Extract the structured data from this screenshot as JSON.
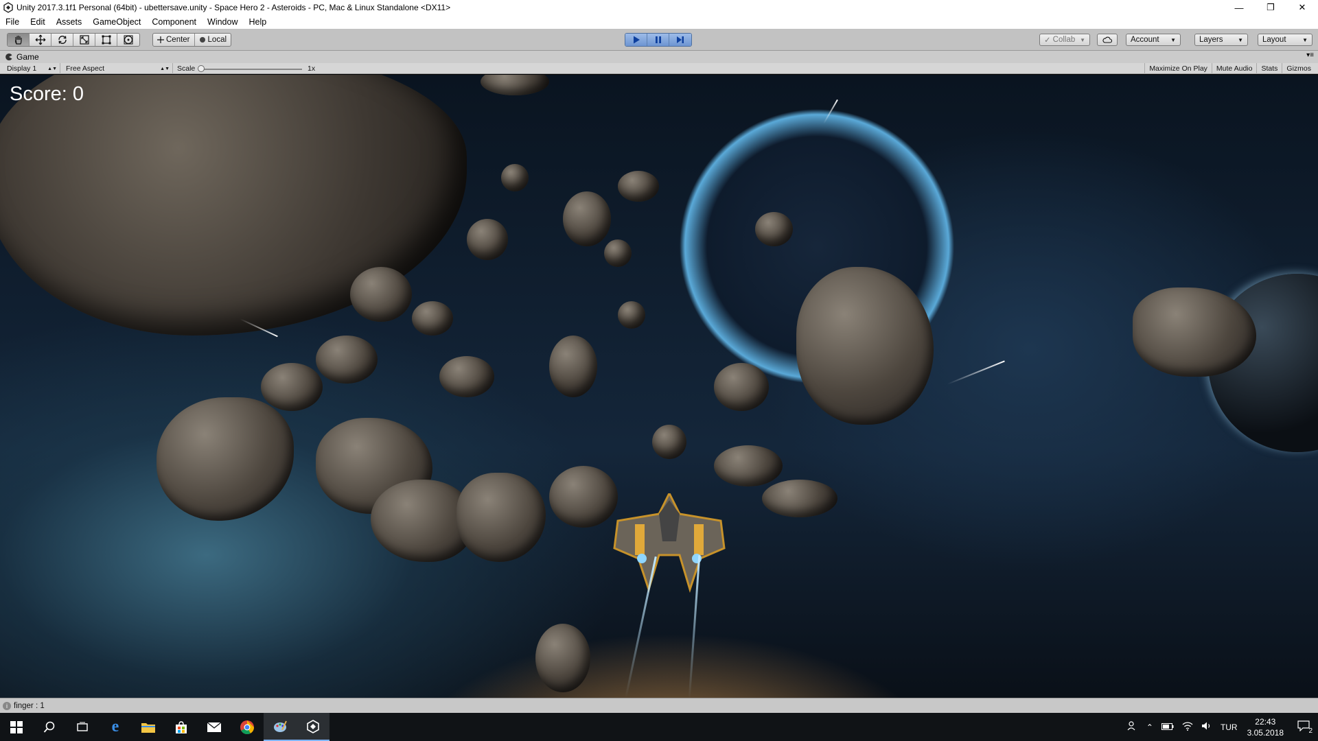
{
  "window": {
    "title": "Unity 2017.3.1f1 Personal (64bit) - ubettersave.unity - Space Hero 2 - Asteroids - PC, Mac & Linux Standalone <DX11>",
    "minimize_icon": "minimize-icon",
    "restore_icon": "restore-icon",
    "close_icon": "close-icon"
  },
  "menu": [
    "File",
    "Edit",
    "Assets",
    "GameObject",
    "Component",
    "Window",
    "Help"
  ],
  "toolbar": {
    "tools": [
      "hand-icon",
      "move-icon",
      "rotate-icon",
      "scale-icon",
      "rect-icon",
      "transform-icon"
    ],
    "pivot_center": "Center",
    "pivot_local": "Local",
    "collab": "Collab",
    "account": "Account",
    "layers": "Layers",
    "layout": "Layout"
  },
  "game_view": {
    "tab_label": "Game",
    "display": "Display 1",
    "aspect": "Free Aspect",
    "scale_label": "Scale",
    "scale_value": "1x",
    "maximize_on_play": "Maximize On Play",
    "mute_audio": "Mute Audio",
    "stats": "Stats",
    "gizmos": "Gizmos",
    "score_text": "Score: 0"
  },
  "status": {
    "message": "finger : 1"
  },
  "taskbar": {
    "language": "TUR",
    "time": "22:43",
    "date": "3.05.2018",
    "notifications": "2"
  },
  "colors": {
    "toolbar_bg": "#c2c2c2",
    "play_active": "#6d95d2",
    "taskbar_bg": "#101316"
  }
}
